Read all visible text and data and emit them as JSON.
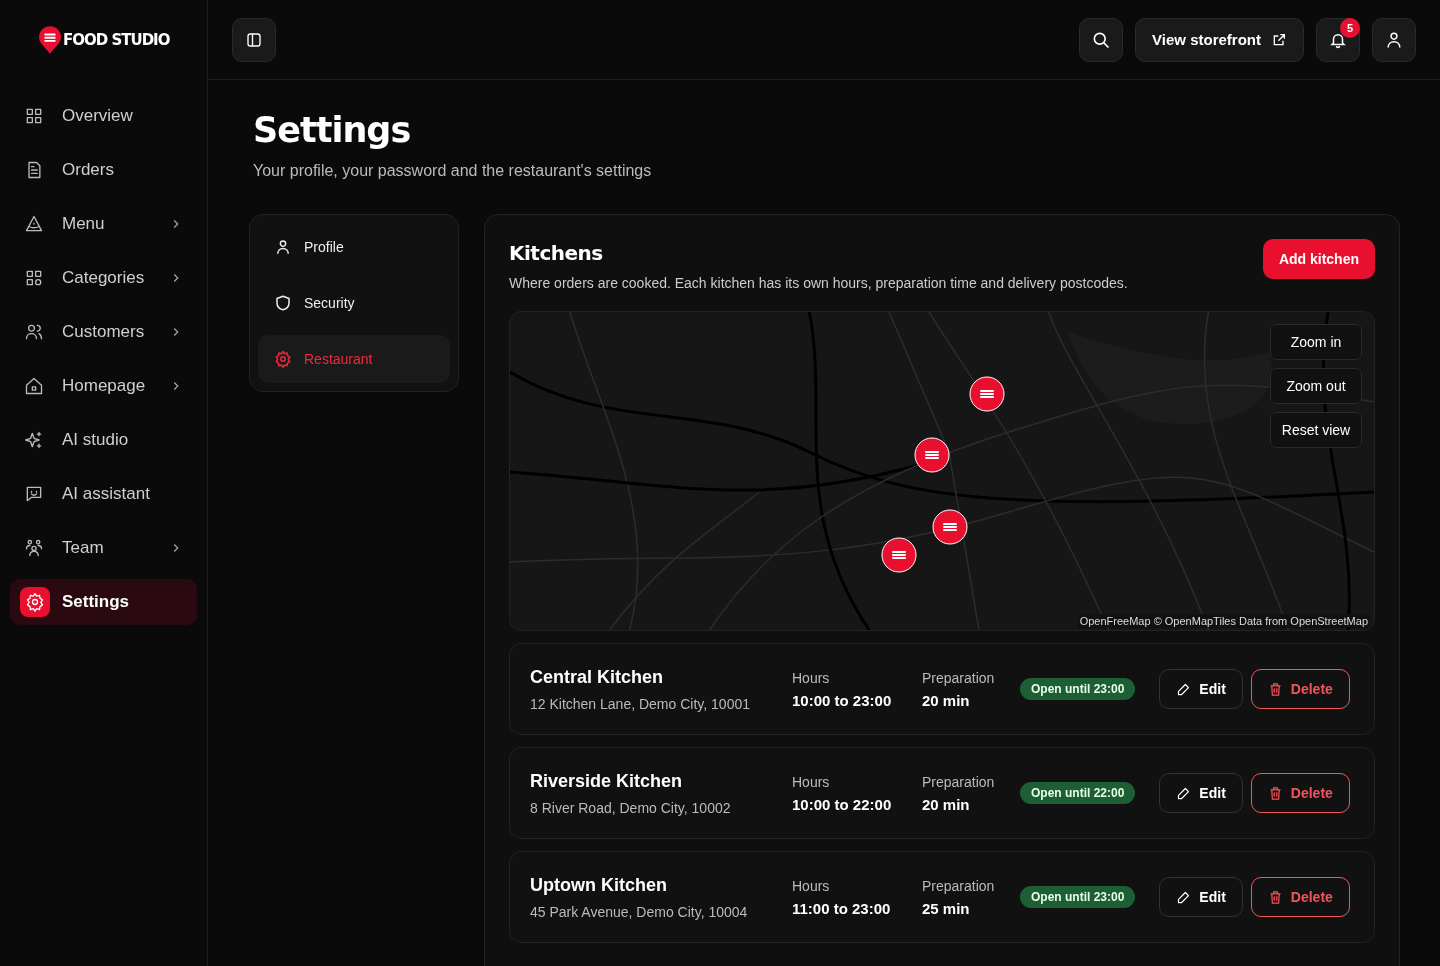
{
  "brand": {
    "name": "FOOD STUDIO"
  },
  "sidebar": {
    "items": [
      {
        "label": "Overview",
        "has_submenu": false,
        "selected": false
      },
      {
        "label": "Orders",
        "has_submenu": false,
        "selected": false
      },
      {
        "label": "Menu",
        "has_submenu": true,
        "selected": false
      },
      {
        "label": "Categories",
        "has_submenu": true,
        "selected": false
      },
      {
        "label": "Customers",
        "has_submenu": true,
        "selected": false
      },
      {
        "label": "Homepage",
        "has_submenu": true,
        "selected": false
      },
      {
        "label": "AI studio",
        "has_submenu": false,
        "selected": false
      },
      {
        "label": "AI assistant",
        "has_submenu": false,
        "selected": false
      },
      {
        "label": "Team",
        "has_submenu": true,
        "selected": false
      },
      {
        "label": "Settings",
        "has_submenu": false,
        "selected": true
      }
    ]
  },
  "topbar": {
    "storefront_button": "View storefront",
    "notification_count": "5"
  },
  "page": {
    "title": "Settings",
    "subtitle": "Your profile, your password and the restaurant's settings"
  },
  "settings_nav": [
    {
      "label": "Profile",
      "selected": false
    },
    {
      "label": "Security",
      "selected": false
    },
    {
      "label": "Restaurant",
      "selected": true
    }
  ],
  "kitchens": {
    "title": "Kitchens",
    "description": "Where orders are cooked. Each kitchen has its own hours, preparation time and delivery postcodes.",
    "add_button": "Add kitchen",
    "map": {
      "controls": [
        "Zoom in",
        "Zoom out",
        "Reset view"
      ],
      "attribution": "OpenFreeMap © OpenMapTiles Data from OpenStreetMap"
    },
    "rows": [
      {
        "name": "Central Kitchen",
        "address": "12 Kitchen Lane, Demo City, 10001",
        "hours_label": "Hours",
        "hours": "10:00 to 23:00",
        "preparation_label": "Preparation",
        "preparation": "20 min",
        "status": "Open until 23:00",
        "edit_label": "Edit",
        "delete_label": "Delete"
      },
      {
        "name": "Riverside Kitchen",
        "address": "8 River Road, Demo City, 10002",
        "hours_label": "Hours",
        "hours": "10:00 to 22:00",
        "preparation_label": "Preparation",
        "preparation": "20 min",
        "status": "Open until 22:00",
        "edit_label": "Edit",
        "delete_label": "Delete"
      },
      {
        "name": "Uptown Kitchen",
        "address": "45 Park Avenue, Demo City, 10004",
        "hours_label": "Hours",
        "hours": "11:00 to 23:00",
        "preparation_label": "Preparation",
        "preparation": "25 min",
        "status": "Open until 23:00",
        "edit_label": "Edit",
        "delete_label": "Delete"
      }
    ]
  }
}
